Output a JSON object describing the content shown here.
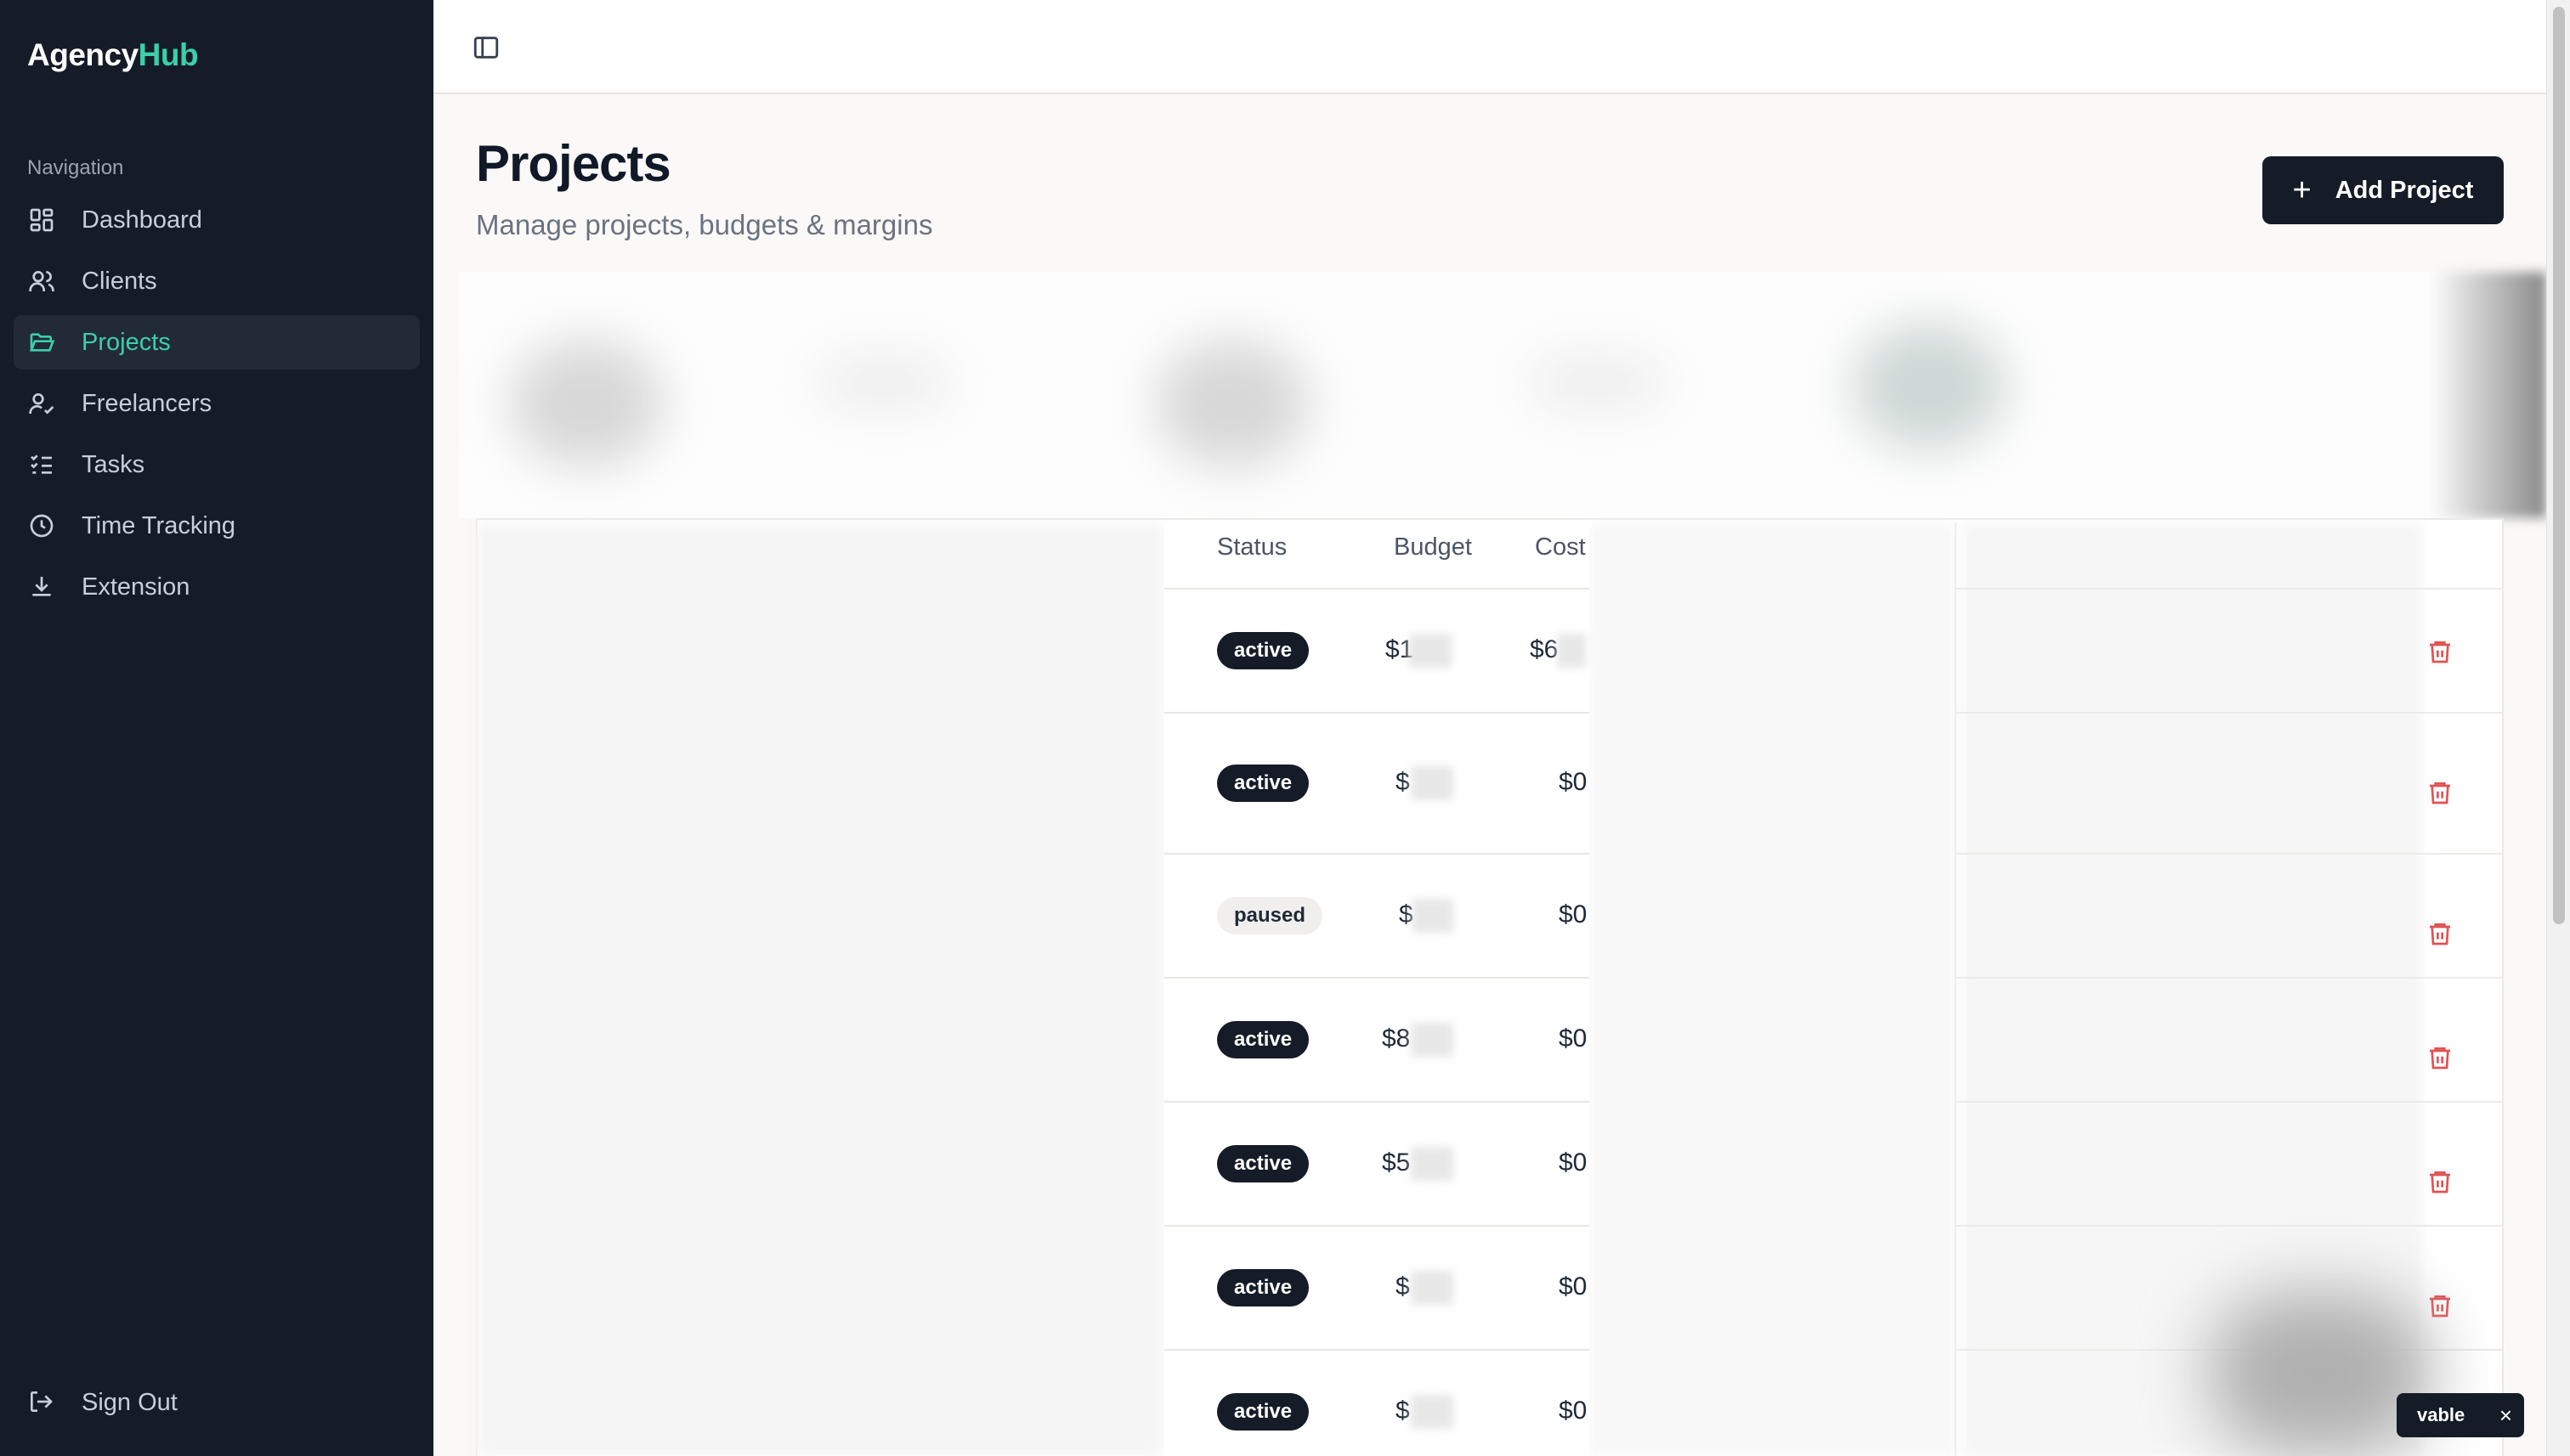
{
  "brand": {
    "name_part1": "Agency",
    "name_part2": "Hub"
  },
  "sidebar": {
    "heading": "Navigation",
    "items": [
      {
        "label": "Dashboard",
        "icon": "dashboard-icon",
        "active": false
      },
      {
        "label": "Clients",
        "icon": "users-icon",
        "active": false
      },
      {
        "label": "Projects",
        "icon": "folder-open-icon",
        "active": true
      },
      {
        "label": "Freelancers",
        "icon": "user-check-icon",
        "active": false
      },
      {
        "label": "Tasks",
        "icon": "list-checks-icon",
        "active": false
      },
      {
        "label": "Time Tracking",
        "icon": "clock-icon",
        "active": false
      },
      {
        "label": "Extension",
        "icon": "download-icon",
        "active": false
      }
    ],
    "signout_label": "Sign Out"
  },
  "header": {
    "title": "Projects",
    "subtitle": "Manage projects, budgets & margins",
    "add_button_label": "Add Project",
    "add_button_icon": "plus-icon"
  },
  "table": {
    "headers": {
      "status": "Status",
      "budget": "Budget",
      "cost": "Cost"
    },
    "rows": [
      {
        "status": "active",
        "budget_prefix": "$1",
        "cost": "$6"
      },
      {
        "status": "active",
        "budget_prefix": "$",
        "cost": "$0"
      },
      {
        "status": "paused",
        "budget_prefix": "$",
        "cost": "$0"
      },
      {
        "status": "active",
        "budget_prefix": "$8",
        "cost": "$0"
      },
      {
        "status": "active",
        "budget_prefix": "$5",
        "cost": "$0"
      },
      {
        "status": "active",
        "budget_prefix": "$",
        "cost": "$0"
      },
      {
        "status": "active",
        "budget_prefix": "$",
        "cost": "$0"
      }
    ],
    "row_action_icon": "trash-icon"
  },
  "toast": {
    "text": "vable",
    "close_icon": "close-icon"
  },
  "colors": {
    "sidebar_bg": "#151c28",
    "accent": "#3ccfa9",
    "danger": "#e05252"
  }
}
